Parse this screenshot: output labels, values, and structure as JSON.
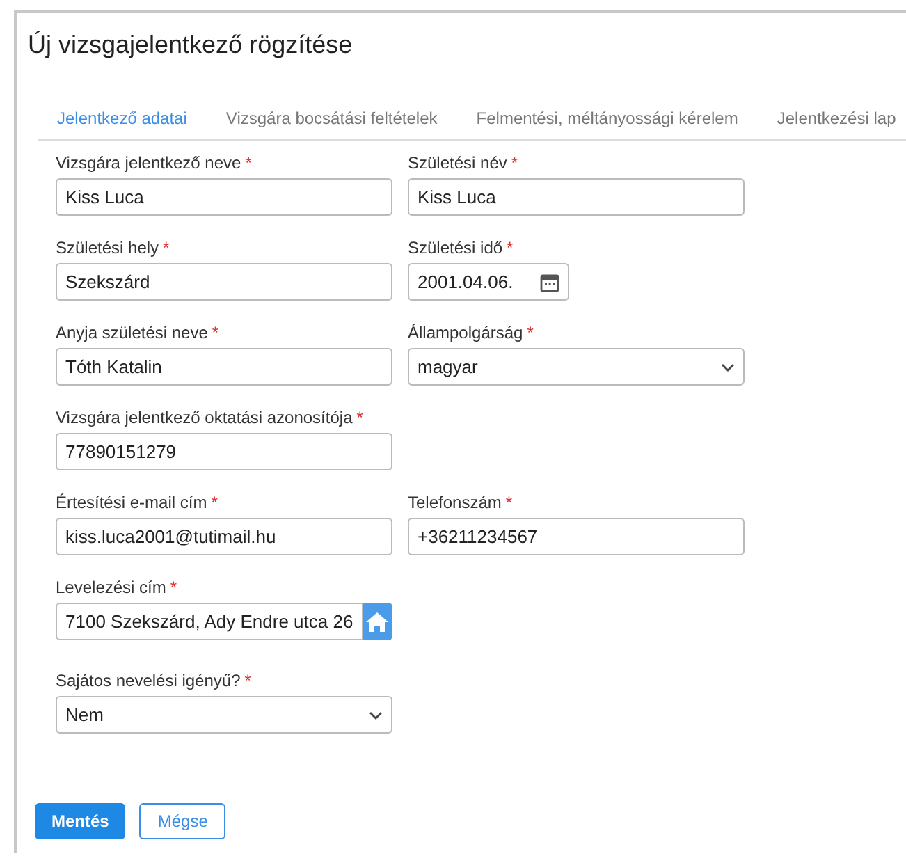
{
  "title": "Új vizsgajelentkező rögzítése",
  "tabs": [
    {
      "label": "Jelentkező adatai",
      "selected": true
    },
    {
      "label": "Vizsgára bocsátási feltételek",
      "selected": false
    },
    {
      "label": "Felmentési, méltányossági kérelem",
      "selected": false
    },
    {
      "label": "Jelentkezési lap",
      "selected": false
    }
  ],
  "rows": [
    [
      {
        "label": "Vizsgára jelentkező neve",
        "mark": "*",
        "kind": "text",
        "value": "Kiss Luca"
      },
      {
        "label": "Születési név",
        "mark": "*",
        "kind": "text",
        "value": "Kiss Luca"
      }
    ],
    [
      {
        "label": "Születési hely",
        "mark": "*",
        "kind": "text",
        "value": "Szekszárd"
      },
      {
        "label": "Születési idő",
        "mark": "*",
        "kind": "date",
        "value": "2001.04.06."
      }
    ],
    [
      {
        "label": "Anyja születési neve",
        "mark": "*",
        "kind": "text",
        "value": "Tóth Katalin"
      },
      {
        "label": "Állampolgárság",
        "mark": "*",
        "kind": "select",
        "value": "magyar"
      }
    ],
    [
      {
        "label": "Vizsgára jelentkező oktatási azonosítója",
        "mark": "*",
        "kind": "text",
        "value": "77890151279"
      }
    ],
    [
      {
        "label": "Értesítési e-mail cím",
        "mark": "*",
        "kind": "text",
        "value": "kiss.luca2001@tutimail.hu"
      },
      {
        "label": "Telefonszám",
        "mark": "*",
        "kind": "text",
        "value": "+36211234567"
      }
    ],
    [
      {
        "label": "Levelezési cím",
        "mark": "*",
        "kind": "address",
        "value": "7100 Szekszárd, Ady Endre utca 26"
      }
    ],
    [
      {
        "label": "Sajátos nevelési igényű?",
        "mark": "*",
        "kind": "select",
        "value": "Nem"
      }
    ]
  ],
  "buttons": [
    {
      "label": "Mentés",
      "kind": "primary"
    },
    {
      "label": "Mégse",
      "kind": "secondary"
    }
  ]
}
